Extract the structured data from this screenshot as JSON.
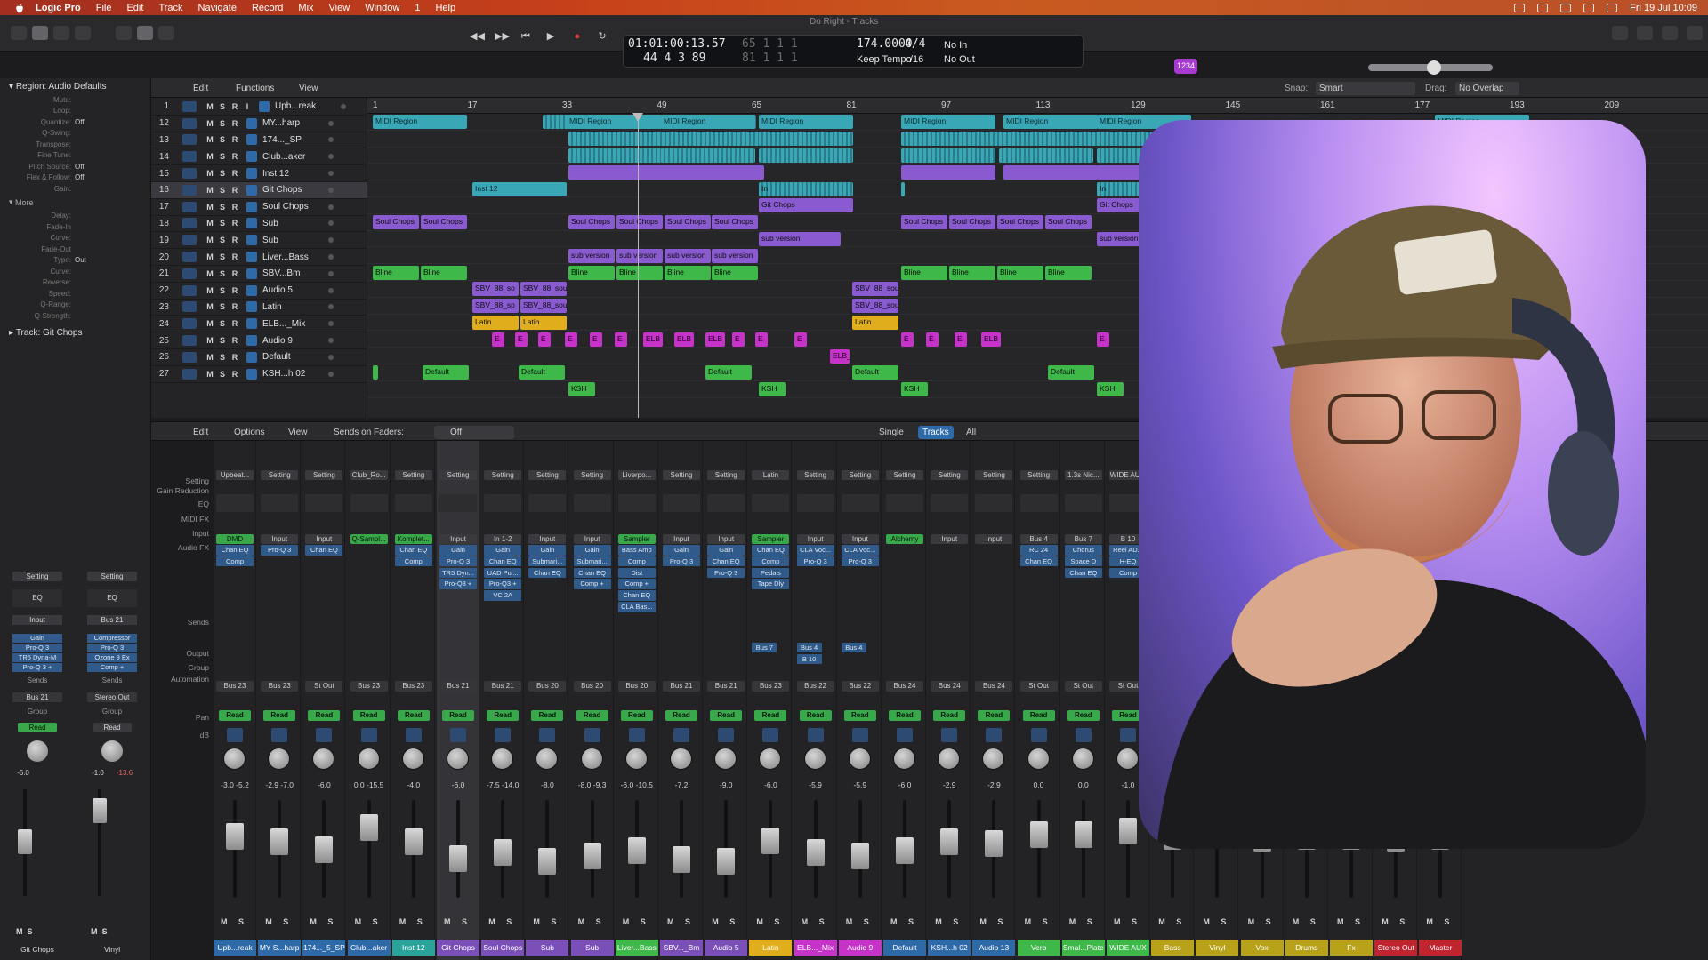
{
  "menubar": {
    "app": "Logic Pro",
    "items": [
      "File",
      "Edit",
      "Track",
      "Navigate",
      "Record",
      "Mix",
      "View",
      "Window",
      "1",
      "Help"
    ],
    "clock": "Fri 19 Jul  10:09"
  },
  "window_title": "Do Right - Tracks",
  "lcd": {
    "time": "01:01:00:13.57",
    "bars_a": "65   1   1     1",
    "bars": "44   4   3    89",
    "bars_b": "81   1   1     1",
    "tempo": "174.0000",
    "tempo_mode": "Keep Tempo",
    "sig": "4/4",
    "div": "/16",
    "in": "No In",
    "out": "No Out"
  },
  "count_in": "1234",
  "inspector": {
    "region_header": "Region: Audio Defaults",
    "rows": [
      {
        "k": "Mute:",
        "v": ""
      },
      {
        "k": "Loop:",
        "v": ""
      },
      {
        "k": "Quantize:",
        "v": "Off"
      },
      {
        "k": "Q-Swing:",
        "v": ""
      },
      {
        "k": "Transpose:",
        "v": ""
      },
      {
        "k": "Fine Tune:",
        "v": ""
      },
      {
        "k": "Pitch Source:",
        "v": "Off"
      },
      {
        "k": "Flex & Follow:",
        "v": "Off"
      },
      {
        "k": "Gain:",
        "v": ""
      }
    ],
    "more": "More",
    "more_rows": [
      {
        "k": "Delay:",
        "v": ""
      },
      {
        "k": "Fade-In",
        "v": ""
      },
      {
        "k": "Curve:",
        "v": ""
      },
      {
        "k": "Fade-Out",
        "v": ""
      },
      {
        "k": "Type:",
        "v": "Out"
      },
      {
        "k": "Curve:",
        "v": ""
      },
      {
        "k": "Reverse:",
        "v": ""
      },
      {
        "k": "Speed:",
        "v": ""
      },
      {
        "k": "Q-Range:",
        "v": ""
      },
      {
        "k": "Q-Strength:",
        "v": ""
      }
    ],
    "track_header": "Track:",
    "track_name": "Git Chops",
    "strip1": {
      "setting": "Setting",
      "eq": "EQ",
      "input": "Input",
      "fx": [
        "Gain",
        "Pro-Q 3",
        "TR5 Dyna-M",
        "Pro-Q 3 +"
      ],
      "sends": "Sends",
      "out": "Bus 21",
      "group": "Group",
      "read": "Read",
      "db1": "-6.0",
      "name": "Git Chops"
    },
    "strip2": {
      "setting": "Setting",
      "eq": "EQ",
      "input": "Bus 21",
      "fx": [
        "Compressor",
        "Pro-Q 3",
        "Ozone 9 Ex",
        "Comp +"
      ],
      "sends": "Sends",
      "out": "Stereo Out",
      "group": "Group",
      "read": "Read",
      "db1": "-1.0",
      "db2": "-13.6",
      "name": "Vinyl"
    }
  },
  "tracks_header": {
    "edit": "Edit",
    "functions": "Functions",
    "view": "View",
    "snap_label": "Snap:",
    "snap": "Smart",
    "drag_label": "Drag:",
    "drag": "No Overlap"
  },
  "ruler": [
    "1",
    "17",
    "33",
    "49",
    "65",
    "81",
    "97",
    "113",
    "129",
    "145",
    "161",
    "177",
    "193",
    "209"
  ],
  "tracks": [
    {
      "num": "1",
      "name": "Upb...reak"
    },
    {
      "num": "12",
      "name": "MY...harp"
    },
    {
      "num": "13",
      "name": "174..._SP"
    },
    {
      "num": "14",
      "name": "Club...aker"
    },
    {
      "num": "15",
      "name": "Inst 12"
    },
    {
      "num": "16",
      "name": "Git Chops"
    },
    {
      "num": "17",
      "name": "Soul Chops"
    },
    {
      "num": "18",
      "name": "Sub"
    },
    {
      "num": "19",
      "name": "Sub"
    },
    {
      "num": "20",
      "name": "Liver...Bass"
    },
    {
      "num": "21",
      "name": "SBV...Bm"
    },
    {
      "num": "22",
      "name": "Audio 5"
    },
    {
      "num": "23",
      "name": "Latin"
    },
    {
      "num": "24",
      "name": "ELB..._Mix"
    },
    {
      "num": "25",
      "name": "Audio 9"
    },
    {
      "num": "26",
      "name": "Default"
    },
    {
      "num": "27",
      "name": "KSH...h 02"
    }
  ],
  "region_labels": {
    "midi": "MIDI Region",
    "inst": "Inst 12",
    "git": "Git Chops",
    "soul": "Soul Chops",
    "subv": "sub version",
    "bline": "Bline",
    "sbv": "SBV_88_so",
    "sbv2": "SBV_88_sou",
    "latin": "Latin",
    "elb": "ELB",
    "elb_": "ELB_",
    "e": "E",
    "default": "Default",
    "ksh": "KSH",
    "inl": "In"
  },
  "mixer_header": {
    "edit": "Edit",
    "options": "Options",
    "view": "View",
    "sends": "Sends on Faders:",
    "sends_val": "Off",
    "single": "Single",
    "tracks": "Tracks",
    "all": "All"
  },
  "mixer_labels": [
    "Setting",
    "Gain Reduction",
    "EQ",
    "MIDI FX",
    "Input",
    "Audio FX",
    "Sends",
    "Output",
    "Group",
    "Automation",
    "Pan",
    "dB"
  ],
  "strips": [
    {
      "set": "Upbeat...",
      "inp": "DMD",
      "ig": true,
      "fx": [
        "Chan EQ",
        "Comp"
      ],
      "snd": [],
      "out": "Bus 23",
      "aut": "Read",
      "db": "-3.0  -5.2",
      "name": "Upb...reak",
      "color": "#2f6aa8"
    },
    {
      "set": "Setting",
      "inp": "Input",
      "ig": false,
      "fx": [
        "Pro-Q 3"
      ],
      "snd": [],
      "out": "Bus 23",
      "aut": "Read",
      "db": "-2.9  -7.0",
      "name": "MY S...harp",
      "color": "#2f6aa8"
    },
    {
      "set": "Setting",
      "inp": "Input",
      "ig": false,
      "fx": [
        "Chan EQ"
      ],
      "snd": [],
      "out": "St Out",
      "aut": "Read",
      "db": "-6.0",
      "name": "174..._5_SP",
      "color": "#2f6aa8"
    },
    {
      "set": "Club_Ro...",
      "inp": "Q-Sampl...",
      "ig": true,
      "fx": [],
      "snd": [],
      "out": "Bus 23",
      "aut": "Read",
      "db": "0.0  -15.5",
      "name": "Club...aker",
      "color": "#2f6aa8"
    },
    {
      "set": "Setting",
      "inp": "Komplet...",
      "ig": true,
      "fx": [
        "Chan EQ",
        "Comp"
      ],
      "snd": [],
      "out": "Bus 23",
      "aut": "Read",
      "db": "-4.0",
      "name": "Inst 12",
      "color": "#2aa39a"
    },
    {
      "set": "Setting",
      "inp": "Input",
      "ig": false,
      "fx": [
        "Gain",
        "Pro-Q 3",
        "TR5 Dyn...",
        "Pro-Q3 +"
      ],
      "snd": [],
      "out": "Bus 21",
      "aut": "Read",
      "db": "-6.0",
      "name": "Git Chops",
      "color": "#7a4fb8",
      "sel": true
    },
    {
      "set": "Setting",
      "inp": "In 1-2",
      "ig": false,
      "fx": [
        "Gain",
        "Chan EQ",
        "UAD Pul...",
        "Pro-Q3 +",
        "VC 2A"
      ],
      "snd": [],
      "out": "Bus 21",
      "aut": "Read",
      "db": "-7.5  -14.0",
      "name": "Soul Chops",
      "color": "#7a4fb8"
    },
    {
      "set": "Setting",
      "inp": "Input",
      "ig": false,
      "fx": [
        "Gain",
        "Submari...",
        "Chan EQ"
      ],
      "snd": [],
      "out": "Bus 20",
      "aut": "Read",
      "db": "-8.0",
      "name": "Sub",
      "color": "#7a4fb8"
    },
    {
      "set": "Setting",
      "inp": "Input",
      "ig": false,
      "fx": [
        "Gain",
        "Submari...",
        "Chan EQ",
        "Comp +"
      ],
      "snd": [],
      "out": "Bus 20",
      "aut": "Read",
      "db": "-8.0  -9.3",
      "name": "Sub",
      "color": "#7a4fb8"
    },
    {
      "set": "Liverpo...",
      "inp": "Sampler",
      "ig": true,
      "fx": [
        "Bass Amp",
        "Comp",
        "Dist",
        "Comp +",
        "Chan EQ",
        "CLA Bas..."
      ],
      "snd": [],
      "out": "Bus 20",
      "aut": "Read",
      "db": "-6.0  -10.5",
      "name": "Liver...Bass",
      "color": "#3fb84a"
    },
    {
      "set": "Setting",
      "inp": "Input",
      "ig": false,
      "fx": [
        "Gain",
        "Pro-Q 3"
      ],
      "snd": [],
      "out": "Bus 21",
      "aut": "Read",
      "db": "-7.2",
      "name": "SBV..._Bm",
      "color": "#7a4fb8"
    },
    {
      "set": "Setting",
      "inp": "Input",
      "ig": false,
      "fx": [
        "Gain",
        "Chan EQ",
        "Pro-Q 3"
      ],
      "snd": [],
      "out": "Bus 21",
      "aut": "Read",
      "db": "-9.0",
      "name": "Audio 5",
      "color": "#7a4fb8"
    },
    {
      "set": "Latin",
      "inp": "Sampler",
      "ig": true,
      "fx": [
        "Chan EQ",
        "Comp",
        "Pedals",
        "Tape Dly"
      ],
      "snd": [
        "Bus 7"
      ],
      "out": "Bus 23",
      "aut": "Read",
      "db": "-6.0",
      "name": "Latin",
      "color": "#e0ad1c"
    },
    {
      "set": "Setting",
      "inp": "Input",
      "ig": false,
      "fx": [
        "CLA Voc...",
        "Pro-Q 3"
      ],
      "snd": [
        "Bus 4",
        "B 10"
      ],
      "out": "Bus 22",
      "aut": "Read",
      "db": "-5.9",
      "name": "ELB..._Mix",
      "color": "#c533c8"
    },
    {
      "set": "Setting",
      "inp": "Input",
      "ig": false,
      "fx": [
        "CLA Voc...",
        "Pro-Q 3"
      ],
      "snd": [
        "Bus 4"
      ],
      "out": "Bus 22",
      "aut": "Read",
      "db": "-5.9",
      "name": "Audio 9",
      "color": "#c533c8"
    },
    {
      "set": "Setting",
      "inp": "Alchemy",
      "ig": true,
      "fx": [],
      "snd": [],
      "out": "Bus 24",
      "aut": "Read",
      "db": "-6.0",
      "name": "Default",
      "color": "#2f6aa8"
    },
    {
      "set": "Setting",
      "inp": "Input",
      "ig": false,
      "fx": [],
      "snd": [],
      "out": "Bus 24",
      "aut": "Read",
      "db": "-2.9",
      "name": "KSH...h 02",
      "color": "#2f6aa8"
    },
    {
      "set": "Setting",
      "inp": "Input",
      "ig": false,
      "fx": [],
      "snd": [],
      "out": "Bus 24",
      "aut": "Read",
      "db": "-2.9",
      "name": "Audio 13",
      "color": "#2f6aa8"
    },
    {
      "set": "Setting",
      "inp": "Bus 4",
      "ig": false,
      "fx": [
        "RC 24",
        "Chan EQ"
      ],
      "snd": [],
      "out": "St Out",
      "aut": "Read",
      "db": "0.0",
      "name": "Verb",
      "color": "#3fb84a"
    },
    {
      "set": "1.3s Nic...",
      "inp": "Bus 7",
      "ig": false,
      "fx": [
        "Chorus",
        "Space D",
        "Chan EQ"
      ],
      "snd": [],
      "out": "St Out",
      "aut": "Read",
      "db": "0.0",
      "name": "Smal...Plate",
      "color": "#3fb84a"
    },
    {
      "set": "WIDE AU...",
      "inp": "B 10",
      "ig": false,
      "fx": [
        "Reel AD...",
        "H-EQ",
        "Comp"
      ],
      "snd": [],
      "out": "St Out",
      "aut": "Read",
      "db": "-1.0",
      "name": "WIDE AUX",
      "color": "#3fb84a"
    },
    {
      "set": "",
      "inp": "",
      "ig": false,
      "fx": [],
      "snd": [],
      "out": "",
      "aut": "",
      "db": "",
      "name": "Bass",
      "color": "#b8a21a"
    },
    {
      "set": "",
      "inp": "",
      "ig": false,
      "fx": [],
      "snd": [],
      "out": "",
      "aut": "",
      "db": "",
      "name": "Vinyl",
      "color": "#b8a21a"
    },
    {
      "set": "",
      "inp": "",
      "ig": false,
      "fx": [],
      "snd": [],
      "out": "",
      "aut": "",
      "db": "",
      "name": "Vox",
      "color": "#b8a21a"
    },
    {
      "set": "",
      "inp": "",
      "ig": false,
      "fx": [],
      "snd": [],
      "out": "",
      "aut": "",
      "db": "",
      "name": "Drums",
      "color": "#b8a21a"
    },
    {
      "set": "",
      "inp": "",
      "ig": false,
      "fx": [],
      "snd": [],
      "out": "",
      "aut": "",
      "db": "",
      "name": "Fx",
      "color": "#b8a21a"
    },
    {
      "set": "",
      "inp": "",
      "ig": false,
      "fx": [],
      "snd": [],
      "out": "",
      "aut": "",
      "db": "",
      "name": "Stereo Out",
      "color": "#c0242e"
    },
    {
      "set": "",
      "inp": "",
      "ig": false,
      "fx": [],
      "snd": [],
      "out": "",
      "aut": "",
      "db": "",
      "name": "Master",
      "color": "#c0242e"
    }
  ]
}
